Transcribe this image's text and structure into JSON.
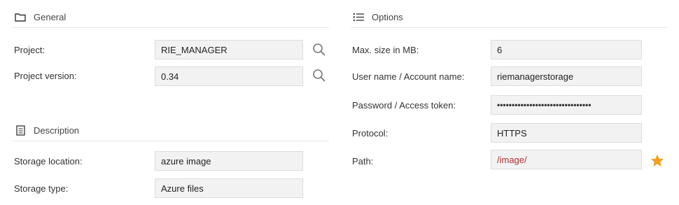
{
  "general": {
    "title": "General",
    "project_label": "Project:",
    "project_value": "RIE_MANAGER",
    "version_label": "Project version:",
    "version_value": "0.34"
  },
  "description": {
    "title": "Description",
    "storage_location_label": "Storage location:",
    "storage_location_value": "azure image",
    "storage_type_label": "Storage type:",
    "storage_type_value": "Azure files"
  },
  "options": {
    "title": "Options",
    "max_size_label": "Max. size in MB:",
    "max_size_value": "6",
    "user_label": "User name / Account name:",
    "user_value": "riemanagerstorage",
    "password_label": "Password / Access token:",
    "password_value": "••••••••••••••••••••••••••••••••",
    "protocol_label": "Protocol:",
    "protocol_value": "HTTPS",
    "path_label": "Path:",
    "path_value": "/image/"
  },
  "colors": {
    "accent_star": "#f0a020",
    "path_text": "#b03030",
    "field_bg": "#f2f2f2"
  },
  "icons": [
    "folder-icon",
    "list-icon",
    "document-icon",
    "search-icon",
    "star-icon"
  ]
}
